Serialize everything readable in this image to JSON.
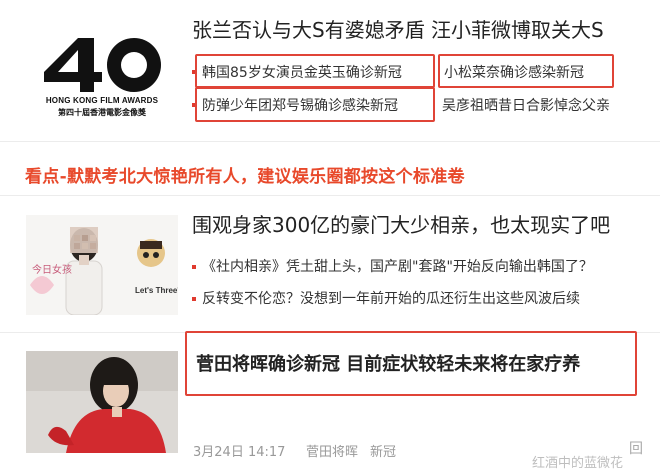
{
  "logo": {
    "number": "40",
    "line1": "HONG KONG FILM AWARDS",
    "line2": "第四十屆香港電影金像獎"
  },
  "article1": {
    "headline": "张兰否认与大S有婆媳矛盾 汪小菲微博取关大S",
    "links": [
      "韩国85岁女演员金英玉确诊新冠",
      "小松菜奈确诊感染新冠",
      "防弹少年团郑号锡确诊感染新冠",
      "吴彦祖晒昔日合影悼念父亲"
    ]
  },
  "banner": "看点-默默考北大惊艳所有人，建议娱乐圈都按这个标准卷",
  "article2": {
    "headline": "围观身家300亿的豪门大少相亲，也太现实了吧",
    "thumb_text_left": "今日女孩",
    "thumb_text_right": "Let's Three'",
    "links": [
      "《社内相亲》凭土甜上头，国产剧\"套路\"开始反向输出韩国了？",
      "反转变不伦恋？没想到一年前开始的瓜还衍生出这些风波后续"
    ]
  },
  "article3": {
    "headline": "菅田将晖确诊新冠 目前症状较轻未来将在家疗养",
    "date": "3月24日 14:17",
    "tags": [
      "菅田将晖",
      "新冠"
    ],
    "comment_icon_text": "回"
  },
  "watermark": "红酒中的蓝微花",
  "colors": {
    "accent_red": "#e04437",
    "banner_orange": "#e8492b",
    "meta_gray": "#999999"
  }
}
